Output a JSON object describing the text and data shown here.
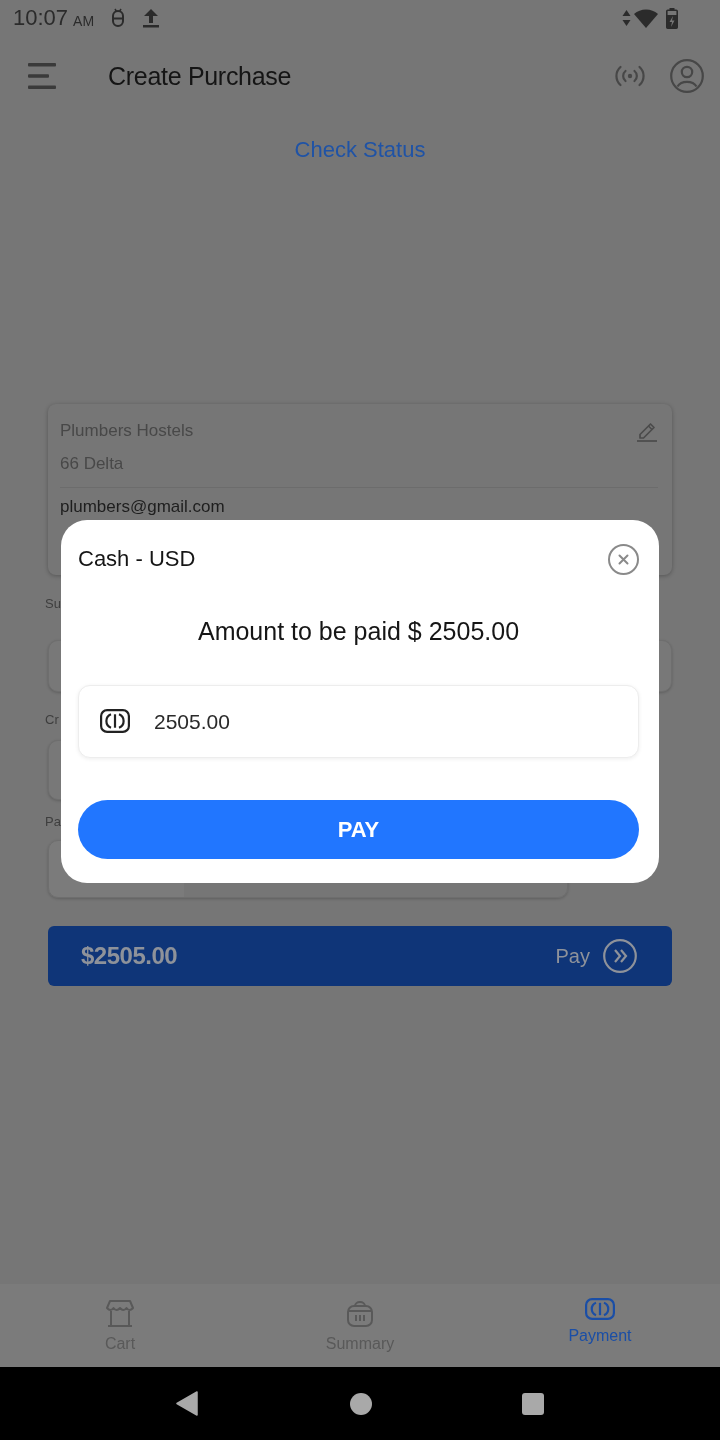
{
  "status_bar": {
    "time": "10:07",
    "meridiem": "AM"
  },
  "app_bar": {
    "title": "Create Purchase"
  },
  "check_status": {
    "label": "Check Status"
  },
  "customer_card": {
    "name": "Plumbers Hostels",
    "address": "66 Delta",
    "email": "plumbers@gmail.com"
  },
  "form_fields": [
    {
      "label": "Su"
    },
    {
      "label": "Cr"
    },
    {
      "label": "Pa"
    }
  ],
  "pay_bar": {
    "total": "$2505.00",
    "label": "Pay"
  },
  "dialog": {
    "title": "Cash - USD",
    "amount_text": "Amount to be paid $ 2505.00",
    "amount_value": "2505.00",
    "button": "PAY"
  },
  "bottom_nav": [
    {
      "label": "Cart",
      "selected": false
    },
    {
      "label": "Summary",
      "selected": false
    },
    {
      "label": "Payment",
      "selected": true
    }
  ]
}
